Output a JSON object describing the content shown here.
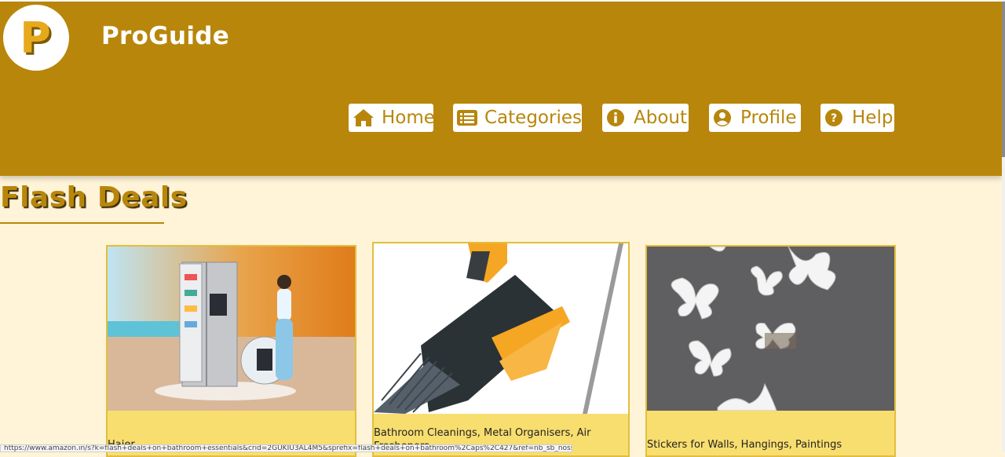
{
  "header": {
    "logo_letter": "P",
    "brand": "ProGuide",
    "nav": [
      {
        "label": "Home",
        "icon": "home-icon"
      },
      {
        "label": "Categories",
        "icon": "list-icon"
      },
      {
        "label": "About",
        "icon": "info-icon"
      },
      {
        "label": "Profile",
        "icon": "user-circle-icon"
      },
      {
        "label": "Help",
        "icon": "question-circle-icon"
      }
    ]
  },
  "main": {
    "section_title": "Flash Deals",
    "cards": [
      {
        "caption": "Haier",
        "image": "refrigerator-photo"
      },
      {
        "caption": "Bathroom Cleanings, Metal Organisers, Air Fresheners",
        "image": "cleaning-brush-photo"
      },
      {
        "caption": "Stickers for Walls, Hangings, Paintings",
        "image": "butterfly-stickers-photo"
      }
    ]
  },
  "status_bar": {
    "url": "https://www.amazon.in/s?k=flash+deals+on+bathroom+essentials&crid=2GUKIU3AL4M5&sprefix=flash+deals+on+bathroom%2Caps%2C427&ref=nb_sb_noss"
  },
  "colors": {
    "header_bg": "#b8860b",
    "page_bg": "#fff4d8",
    "card_bg": "#f8de6f",
    "accent": "#b8860b"
  }
}
